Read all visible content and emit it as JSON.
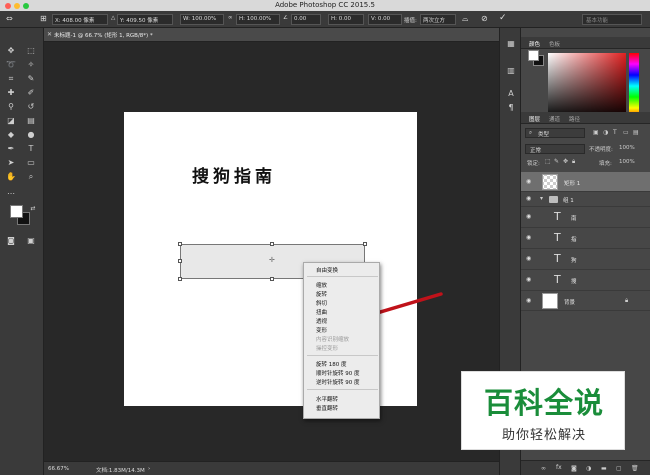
{
  "titlebar": {
    "title": "Adobe Photoshop CC 2015.5"
  },
  "options_bar": {
    "x": "X: 408.00 像素",
    "y": "Y: 409.50 像素",
    "w": "W: 100.00%",
    "h": "H: 100.00%",
    "angle": "0.00",
    "hskew": "H: 0.00",
    "vskew": "V: 0.00",
    "interp_label": "插值:",
    "interp_value": "两次立方",
    "workspace": "基本功能"
  },
  "document": {
    "tab_label": "未标题-1 @ 66.7% (矩形 1, RGB/8*) *",
    "canvas_text": "搜狗指南"
  },
  "context_menu": {
    "items": [
      "自由变换",
      "缩放",
      "旋转",
      "斜切",
      "扭曲",
      "透视",
      "变形",
      "内容识别缩放",
      "操控变形",
      "旋转 180 度",
      "顺时针旋转 90 度",
      "逆时针旋转 90 度",
      "水平翻转",
      "垂直翻转"
    ]
  },
  "status": {
    "zoom": "66.67%",
    "doc": "文档:1.83M/14.3M"
  },
  "color_panel": {
    "tabs": [
      "颜色",
      "色板"
    ]
  },
  "layers_panel": {
    "tabs": [
      "图层",
      "通道",
      "路径"
    ],
    "filter": "类型",
    "blend_mode": "正常",
    "opacity_label": "不透明度:",
    "opacity_value": "100%",
    "lock_label": "锁定:",
    "fill_label": "填充:",
    "fill_value": "100%",
    "layers": [
      {
        "name": "矩形 1"
      },
      {
        "name": "组 1"
      },
      {
        "name": "南"
      },
      {
        "name": "指"
      },
      {
        "name": "狗"
      },
      {
        "name": "搜"
      },
      {
        "name": "背景"
      }
    ]
  },
  "watermark": {
    "title": "百科全说",
    "subtitle": "助你轻松解决"
  }
}
